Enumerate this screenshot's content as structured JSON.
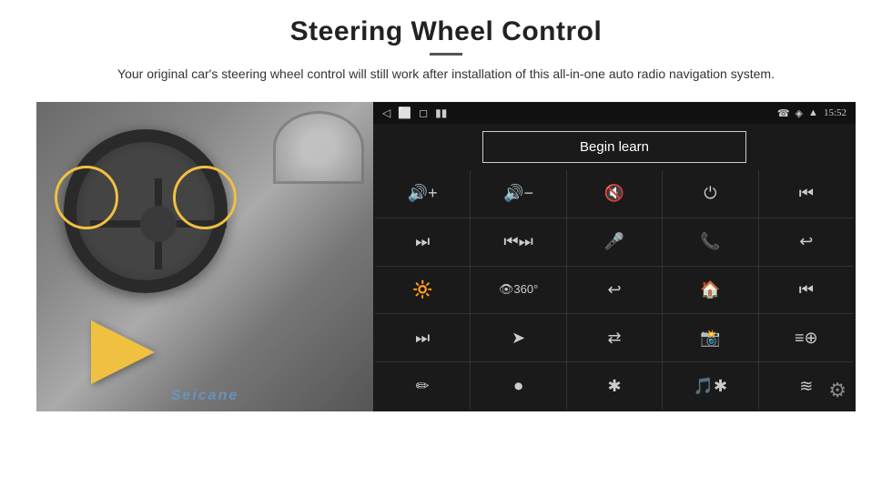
{
  "header": {
    "title": "Steering Wheel Control",
    "subtitle": "Your original car's steering wheel control will still work after installation of this all-in-one auto radio navigation system."
  },
  "status_bar": {
    "left_icons": [
      "◁",
      "⬜",
      "□",
      "▮▮"
    ],
    "right_icons": [
      "☎",
      "◈",
      "▲"
    ],
    "time": "15:52"
  },
  "begin_learn_label": "Begin learn",
  "controls": [
    {
      "icon": "🔊+",
      "label": "vol-up"
    },
    {
      "icon": "🔊−",
      "label": "vol-down"
    },
    {
      "icon": "🔇",
      "label": "mute"
    },
    {
      "icon": "⏻",
      "label": "power"
    },
    {
      "icon": "⏮",
      "label": "prev-track"
    },
    {
      "icon": "⏭",
      "label": "next-track"
    },
    {
      "icon": "⏮⏭",
      "label": "next-prev"
    },
    {
      "icon": "🎤",
      "label": "mic"
    },
    {
      "icon": "📞",
      "label": "call"
    },
    {
      "icon": "↩",
      "label": "hang-up"
    },
    {
      "icon": "🔆",
      "label": "brightness"
    },
    {
      "icon": "👁360",
      "label": "camera-360"
    },
    {
      "icon": "↩",
      "label": "back"
    },
    {
      "icon": "🏠",
      "label": "home"
    },
    {
      "icon": "⏮",
      "label": "skip-back"
    },
    {
      "icon": "⏭",
      "label": "fast-forward"
    },
    {
      "icon": "➤",
      "label": "navigate"
    },
    {
      "icon": "⇄",
      "label": "swap"
    },
    {
      "icon": "🎦",
      "label": "media"
    },
    {
      "icon": "≡",
      "label": "eq"
    },
    {
      "icon": "✏",
      "label": "edit"
    },
    {
      "icon": "⏺",
      "label": "record"
    },
    {
      "icon": "✱",
      "label": "bluetooth"
    },
    {
      "icon": "🎵",
      "label": "music"
    },
    {
      "icon": "≋",
      "label": "spectrum"
    }
  ],
  "seicane_text": "Seicane",
  "gear_icon": "⚙"
}
